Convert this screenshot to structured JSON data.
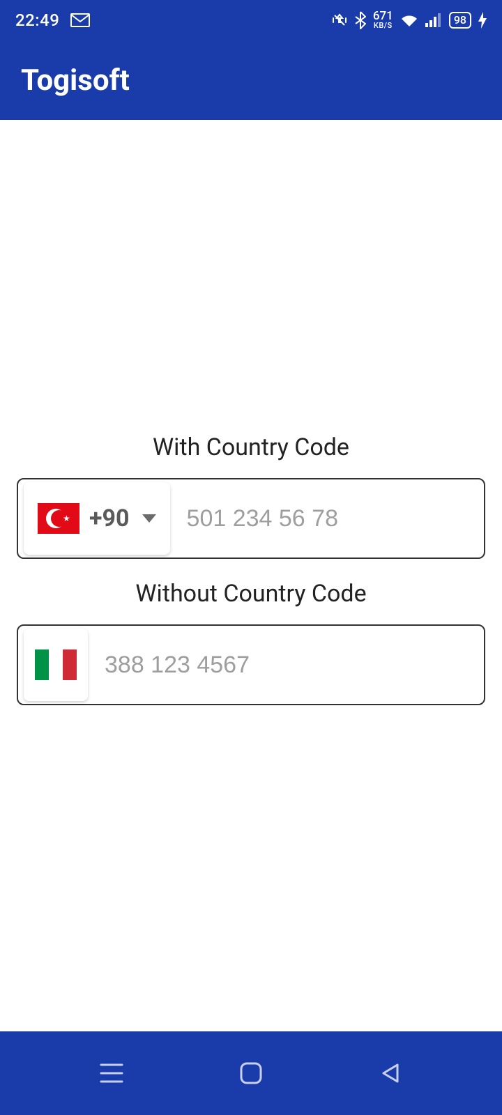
{
  "status": {
    "time": "22:49",
    "network_speed_value": "671",
    "network_speed_unit": "KB/S",
    "battery_percent": "98"
  },
  "app": {
    "title": "Togisoft"
  },
  "labels": {
    "with_code": "With Country Code",
    "without_code": "Without Country Code"
  },
  "fields": {
    "with_code": {
      "dial_code": "+90",
      "flag": "turkey",
      "placeholder": "501 234 56 78",
      "value": ""
    },
    "without_code": {
      "flag": "italy",
      "placeholder": "388 123 4567",
      "value": ""
    }
  }
}
